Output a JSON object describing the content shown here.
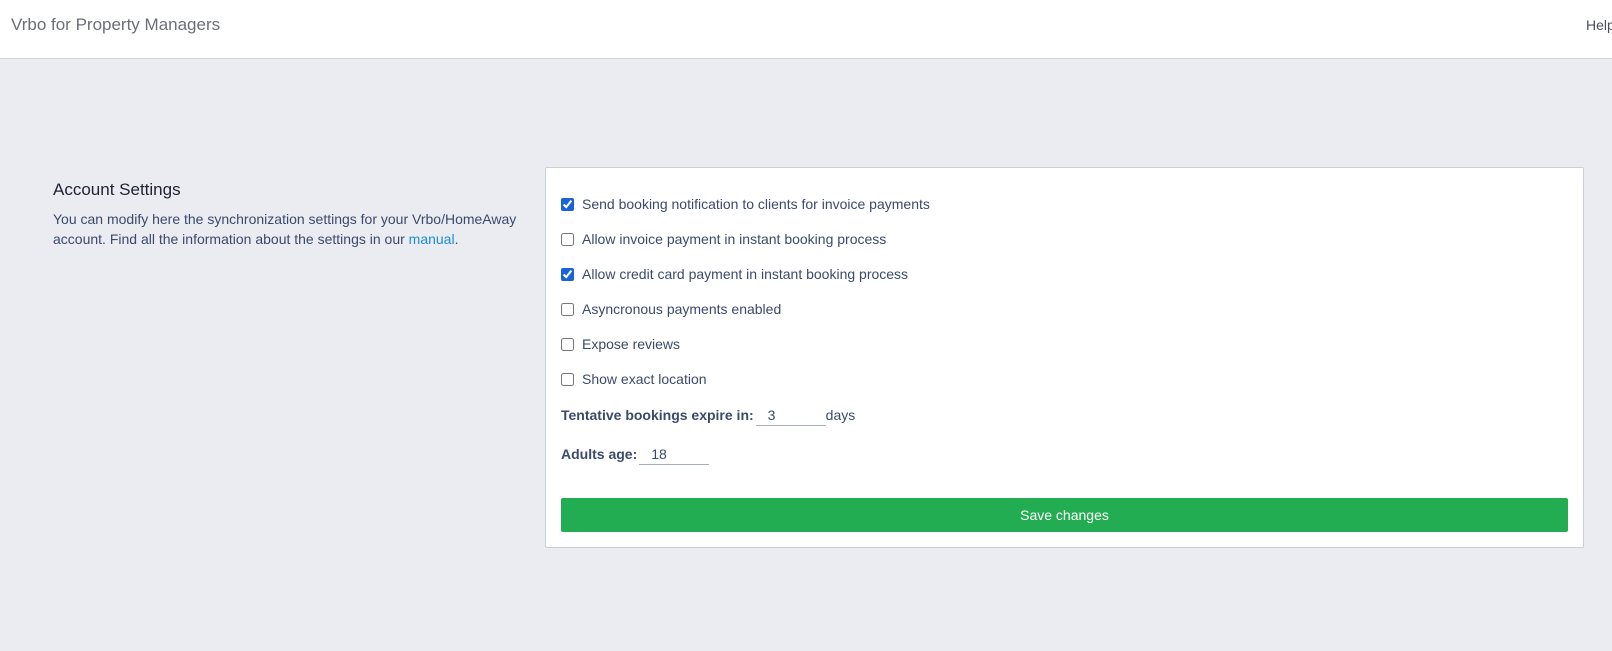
{
  "header": {
    "app_title": "Vrbo for Property Managers",
    "help_label": "Help"
  },
  "intro": {
    "heading": "Account Settings",
    "description": "You can modify here the synchronization settings for your Vrbo/HomeAway account. Find all the information about the settings in our ",
    "manual_link": "manual",
    "description_end": "."
  },
  "settings": {
    "options": [
      {
        "label": "Send booking notification to clients for invoice payments",
        "checked": true
      },
      {
        "label": "Allow invoice payment in instant booking process",
        "checked": false
      },
      {
        "label": "Allow credit card payment in instant booking process",
        "checked": true
      },
      {
        "label": "Asyncronous payments enabled",
        "checked": false
      },
      {
        "label": "Expose reviews",
        "checked": false
      },
      {
        "label": "Show exact location",
        "checked": false
      }
    ],
    "tentative": {
      "label": "Tentative bookings expire in:",
      "value": "3",
      "unit": "days"
    },
    "adults": {
      "label": "Adults age:",
      "value": "18"
    },
    "save_label": "Save changes"
  },
  "colors": {
    "accent_green": "#22ad52",
    "link_blue": "#1a8fd6",
    "checkbox_blue": "#1863d6",
    "background": "#eaecf1"
  }
}
